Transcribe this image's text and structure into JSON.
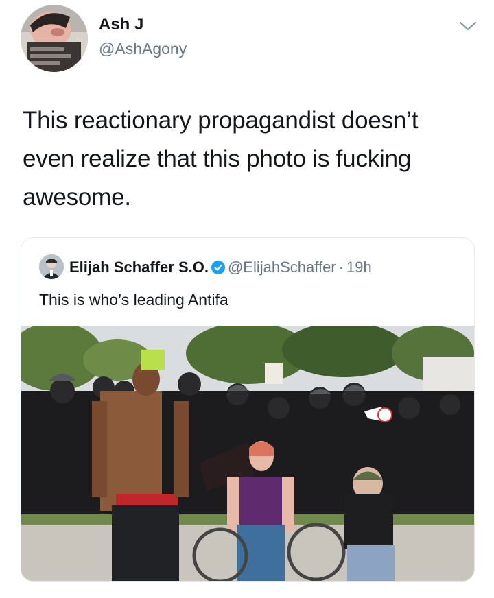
{
  "author": {
    "display_name": "Ash J",
    "handle": "@AshAgony",
    "avatar_icon": "profile-photo"
  },
  "tweet_text": "This reactionary propagandist doesn’t even realize that this photo is fucking awesome.",
  "menu_icon": "chevron-down-icon",
  "quoted_tweet": {
    "display_name": "Elijah Schaffer S.O.",
    "verified_icon": "verified-badge-icon",
    "handle": "@ElijahSchaffer",
    "separator": "·",
    "time": "19h",
    "text": "This is who’s leading Antifa",
    "media": "photo"
  },
  "colors": {
    "text": "#14171a",
    "secondary": "#657786",
    "verified": "#1da1f2",
    "border": "#e1e8ed"
  }
}
